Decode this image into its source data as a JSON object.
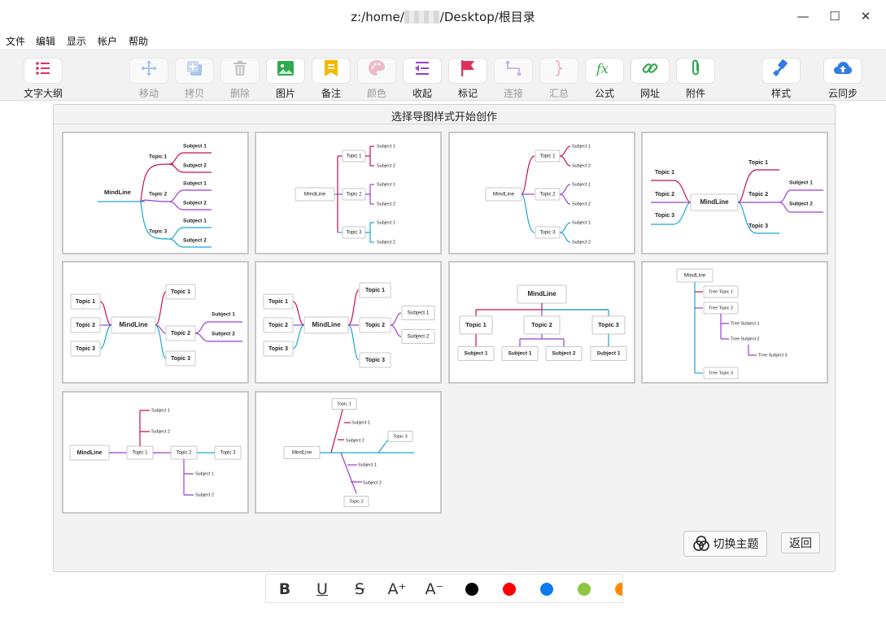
{
  "window": {
    "title_prefix": "z:/home/",
    "title_suffix": "/Desktop/根目录",
    "minimize_glyph": "—",
    "maximize_glyph": "☐",
    "close_glyph": "✕"
  },
  "menu": [
    "文件",
    "编辑",
    "显示",
    "帐户",
    "帮助"
  ],
  "toolbar": {
    "outline": "文字大纲",
    "move": "移动",
    "copy": "拷贝",
    "delete": "删除",
    "image": "图片",
    "note": "备注",
    "color": "颜色",
    "collapse": "收起",
    "mark": "标记",
    "connect": "连接",
    "summary": "汇总",
    "formula": "公式",
    "url": "网址",
    "attach": "附件",
    "style": "样式",
    "sync": "云同步",
    "formula_glyph": "fx"
  },
  "panel": {
    "title": "选择导图样式开始创作",
    "switch_theme": "切换主题",
    "back": "返回"
  },
  "map_text": {
    "root": "MindLine",
    "topic1": "Topic 1",
    "topic2": "Topic 2",
    "topic3": "Topic 3",
    "subject1": "Subject 1",
    "subject2": "Subject 2",
    "tree_topic1": "Tree Topic 1",
    "tree_topic2": "Tree Topic 2",
    "tree_topic3": "Tree Topic 3",
    "tree_subject1": "Tree Subject 1",
    "tree_subject2": "Tree Subject 2",
    "tree_subject3": "Tree Subject 3"
  },
  "format_bar": {
    "bold": "B",
    "underline": "U",
    "strike": "S",
    "grow": "A⁺",
    "shrink": "A⁻",
    "colors": [
      "#000000",
      "#ff0000",
      "#0a7cf0",
      "#8dc63f",
      "#ff8c00"
    ]
  },
  "colors": {
    "c1": "#c8104a",
    "c2": "#9b3fd3",
    "c3": "#1ba6d6",
    "accent_red": "#e0305a",
    "accent_blue": "#2f7de1"
  }
}
